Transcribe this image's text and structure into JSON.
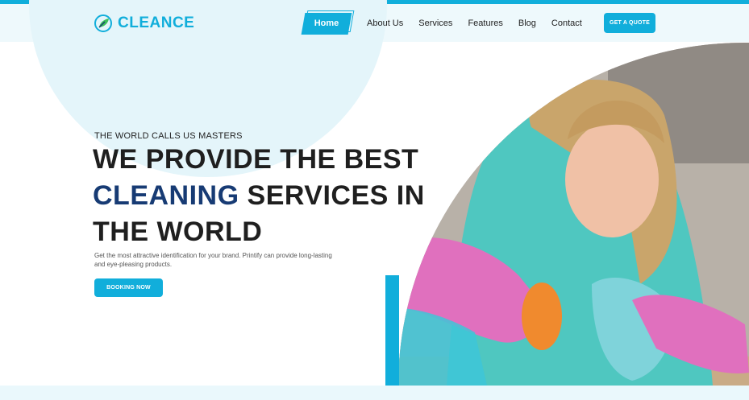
{
  "brand": {
    "name": "CLEANCE",
    "icon": "broom-leaf-icon"
  },
  "nav": {
    "items": [
      "Home",
      "About Us",
      "Services",
      "Features",
      "Blog",
      "Contact"
    ],
    "active": "Home"
  },
  "header": {
    "quote_label": "GET A QUOTE"
  },
  "hero": {
    "tagline": "THE WORLD CALLS US MASTERS",
    "headline_part1": "WE PROVIDE THE BEST",
    "headline_accent": "CLEANING",
    "headline_part2": "SERVICES IN",
    "headline_part3": "THE WORLD",
    "description": "Get the most attractive identification for your brand. Printify can provide long-lasting and eye-pleasing products.",
    "cta_label": "BOOKING NOW"
  },
  "colors": {
    "accent": "#11aedb",
    "headline_accent": "#173b74",
    "hero_circle": "#e4f5fa",
    "header_bg": "#eef9fc"
  }
}
